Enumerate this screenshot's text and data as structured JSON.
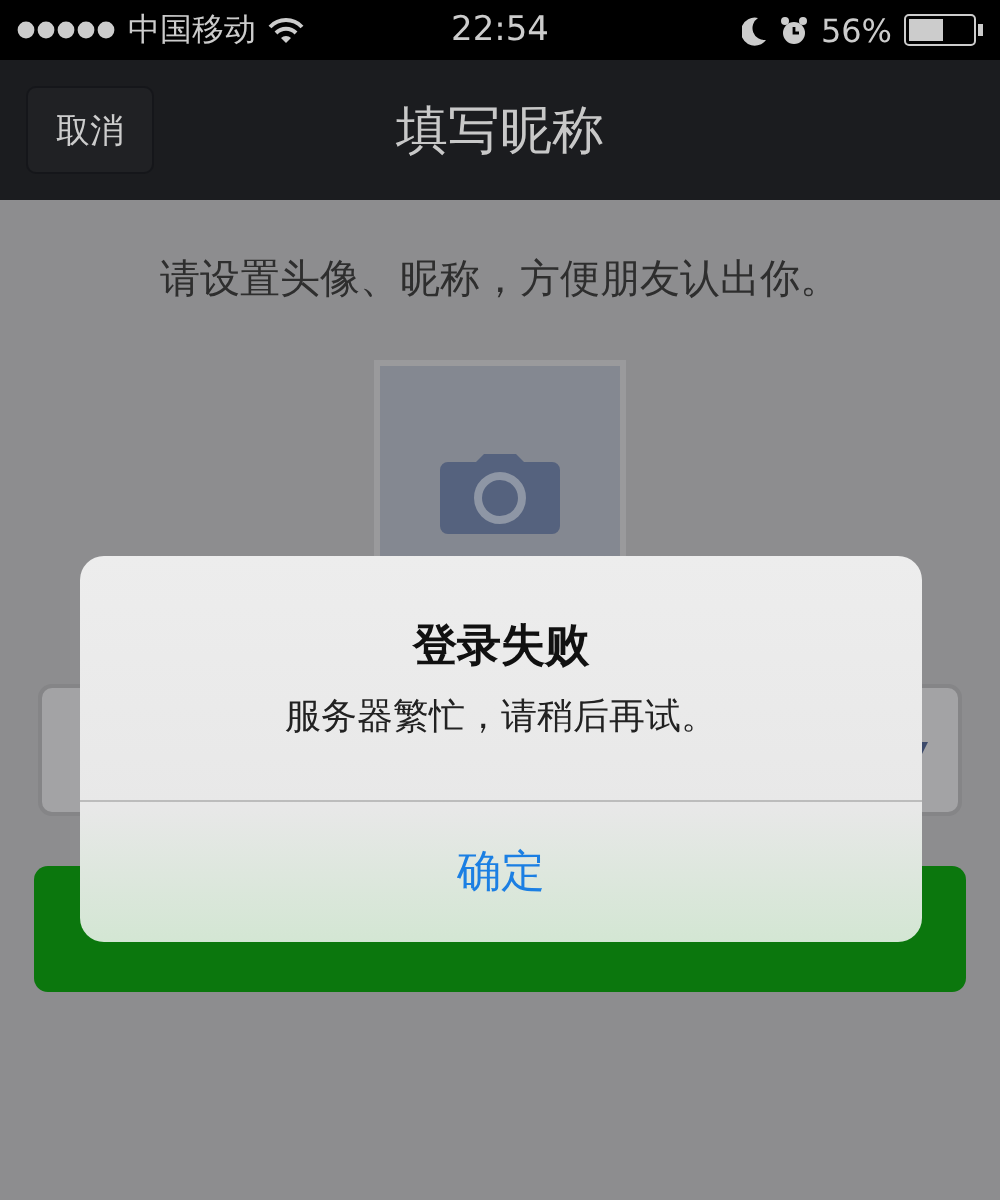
{
  "status_bar": {
    "carrier": "中国移动",
    "time": "22:54",
    "battery": "56%"
  },
  "nav_bar": {
    "cancel": "取消",
    "title": "填写昵称"
  },
  "hint": "请设置头像、昵称，方便朋友认出你。",
  "alert": {
    "title": "登录失败",
    "message": "服务器繁忙，请稍后再试。",
    "button": "确定"
  }
}
